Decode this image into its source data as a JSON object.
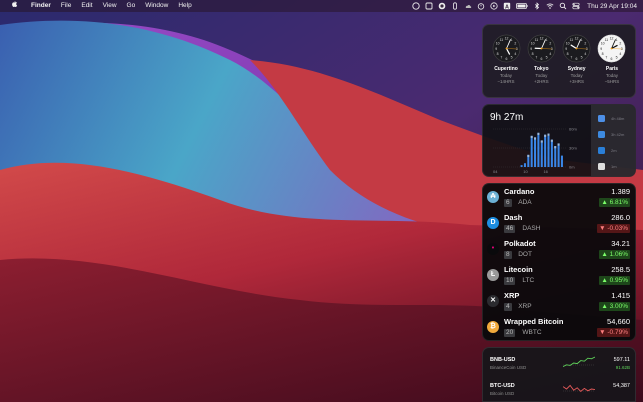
{
  "menubar": {
    "apple_icon": "apple-logo",
    "app_name": "Finder",
    "items": [
      "File",
      "Edit",
      "View",
      "Go",
      "Window",
      "Help"
    ],
    "status_icons": [
      "record-icon",
      "window-icon",
      "app-icon",
      "bolt-icon",
      "cloud-icon",
      "timer-icon",
      "play-icon",
      "font-icon",
      "battery-icon",
      "bluetooth-icon",
      "wifi-icon",
      "search-icon",
      "control-center-icon"
    ],
    "datetime": "Thu 29 Apr  19:04"
  },
  "world_clock": {
    "clocks": [
      {
        "city": "Cupertino",
        "day": "Today",
        "offset": "−14HRS",
        "hour": 5,
        "minute": 4,
        "face": "dark"
      },
      {
        "city": "Tokyo",
        "day": "Today",
        "offset": "+2HRS",
        "hour": 9,
        "minute": 4,
        "face": "dark"
      },
      {
        "city": "Sydney",
        "day": "Today",
        "offset": "+3HRS",
        "hour": 10,
        "minute": 4,
        "face": "dark"
      },
      {
        "city": "Paris",
        "day": "Today",
        "offset": "−5HRS",
        "hour": 2,
        "minute": 4,
        "face": "light"
      }
    ]
  },
  "screen_time": {
    "total": "9h 27m",
    "y_ticks": [
      "60m",
      "30m",
      "0m"
    ],
    "x_ticks": [
      "04",
      "10",
      "16"
    ],
    "bars": [
      0,
      0,
      0,
      0,
      0,
      0,
      0,
      0,
      0.05,
      0.1,
      0.32,
      0.82,
      0.78,
      0.9,
      0.7,
      0.85,
      0.88,
      0.72,
      0.55,
      0.62,
      0.3,
      0
    ],
    "side_items": [
      {
        "icon": "edit-app-icon",
        "time": "4h 48m",
        "color": "#4d8fe6"
      },
      {
        "icon": "safari-icon",
        "time": "3h 42m",
        "color": "#3d8ae0"
      },
      {
        "icon": "finder-icon",
        "time": "2m",
        "color": "#2a7fd8"
      },
      {
        "icon": "notes-icon",
        "time": "1m",
        "color": "#dedede"
      }
    ]
  },
  "crypto": {
    "coins": [
      {
        "name": "Cardano",
        "count": "6",
        "symbol": "ADA",
        "price": "1.389",
        "change": "▲ 6.81%",
        "direction": "up",
        "icon": "cardano-icon",
        "color": "#6bb0d4",
        "glyph": "₳"
      },
      {
        "name": "Dash",
        "count": "46",
        "symbol": "DASH",
        "price": "286.0",
        "change": "▼ -0.03%",
        "direction": "down",
        "icon": "dash-icon",
        "color": "#1c8de0",
        "glyph": "D"
      },
      {
        "name": "Polkadot",
        "count": "8",
        "symbol": "DOT",
        "price": "34.21",
        "change": "▲ 1.06%",
        "direction": "up",
        "icon": "polkadot-icon",
        "color": "#0a0a0c",
        "glyph": "•"
      },
      {
        "name": "Litecoin",
        "count": "10",
        "symbol": "LTC",
        "price": "258.5",
        "change": "▲ 0.95%",
        "direction": "up",
        "icon": "litecoin-icon",
        "color": "#9a9a9a",
        "glyph": "Ł"
      },
      {
        "name": "XRP",
        "count": "4",
        "symbol": "XRP",
        "price": "1.415",
        "change": "▲ 3.00%",
        "direction": "up",
        "icon": "xrp-icon",
        "color": "#2b2b2f",
        "glyph": "✕"
      },
      {
        "name": "Wrapped Bitcoin",
        "count": "20",
        "symbol": "WBTC",
        "price": "54,660",
        "change": "▼ -0.79%",
        "direction": "down",
        "icon": "wrapped-bitcoin-icon",
        "color": "#f0a93c",
        "glyph": "₿"
      }
    ]
  },
  "tickers": [
    {
      "symbol": "BNB-USD",
      "subtitle": "BinanceCoin USD",
      "price": "597.11",
      "volume": "91.62B",
      "direction": "up",
      "color": "#5fd35a",
      "spark": [
        0.2,
        0.35,
        0.3,
        0.5,
        0.45,
        0.7,
        0.65,
        0.9,
        0.85,
        1.0
      ]
    },
    {
      "symbol": "BTC-USD",
      "subtitle": "Bitcoin USD",
      "price": "54,387",
      "volume": "",
      "direction": "down",
      "color": "#e65a5a",
      "spark": [
        0.7,
        0.5,
        0.8,
        0.4,
        0.6,
        0.3,
        0.55,
        0.35,
        0.5,
        0.45
      ]
    }
  ]
}
